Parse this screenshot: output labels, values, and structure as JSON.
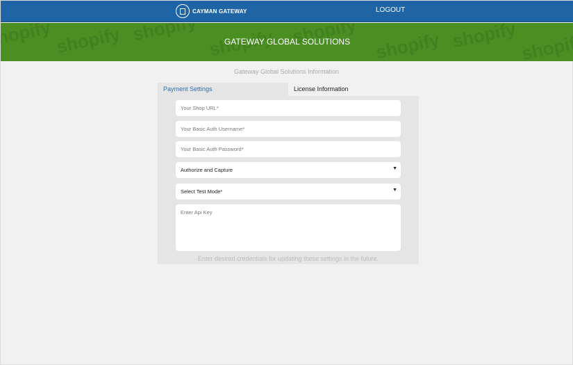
{
  "header": {
    "brand": "CAYMAN GATEWAY",
    "logout": "LOGOUT"
  },
  "banner": {
    "title": "GATEWAY GLOBAL SOLUTIONS",
    "watermark": "shopify"
  },
  "subtitle": "Gateway Global Solutions Information",
  "tabs": [
    {
      "label": "Payment Settings",
      "active": true
    },
    {
      "label": "License Information",
      "active": false
    }
  ],
  "form": {
    "shop_url_placeholder": "Your Shop URL*",
    "username_placeholder": "Your Basic Auth Username*",
    "password_placeholder": "Your Basic Auth Password*",
    "payment_action": "Authorize and Capture",
    "test_mode": "Select Test Mode*",
    "api_key_placeholder": "Enter Api Key",
    "note": "Enter desired credentials for updating these settings in the future."
  }
}
